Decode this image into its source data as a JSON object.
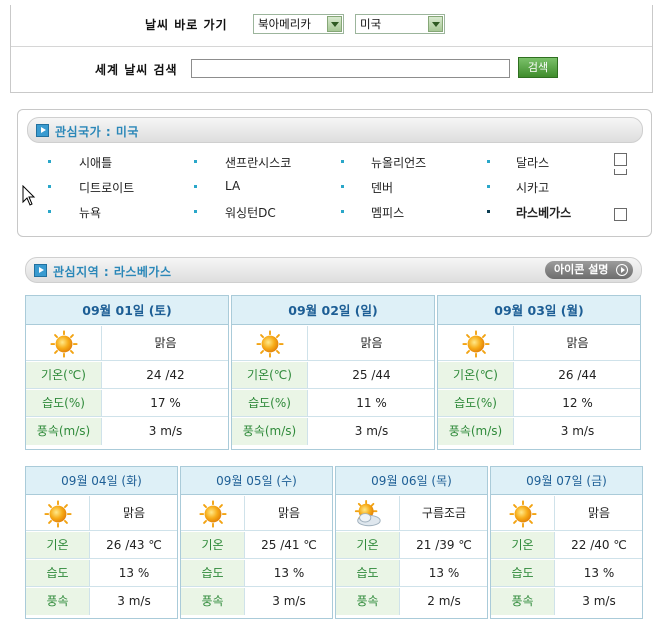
{
  "quick_nav": {
    "label": "날씨 바로 가기",
    "region_selected": "북아메리카",
    "country_selected": "미국"
  },
  "world_search": {
    "label": "세계 날씨 검색",
    "input_value": "",
    "button_label": "검색"
  },
  "interest_country": {
    "title": "관심국가 : 미국",
    "cities": [
      [
        "시애틀",
        "샌프란시스코",
        "뉴올리언즈",
        "달라스"
      ],
      [
        "디트로이트",
        "LA",
        "덴버",
        "시카고"
      ],
      [
        "뉴욕",
        "워싱턴DC",
        "멤피스",
        "라스베가스"
      ]
    ]
  },
  "interest_area": {
    "title": "관심지역 : 라스베가스",
    "legend_button": "아이콘 설명"
  },
  "forecast_top": [
    {
      "date": "09월 01일 (토)",
      "weather_icon": "sun-icon",
      "weather": "맑음",
      "temp_label": "기온(℃)",
      "temp": "24 /42",
      "humidity_label": "습도(%)",
      "humidity": "17 %",
      "wind_label": "풍속(m/s)",
      "wind": "3 m/s"
    },
    {
      "date": "09월 02일 (일)",
      "weather_icon": "sun-icon",
      "weather": "맑음",
      "temp_label": "기온(℃)",
      "temp": "25 /44",
      "humidity_label": "습도(%)",
      "humidity": "11 %",
      "wind_label": "풍속(m/s)",
      "wind": "3 m/s"
    },
    {
      "date": "09월 03일 (월)",
      "weather_icon": "sun-icon",
      "weather": "맑음",
      "temp_label": "기온(℃)",
      "temp": "26 /44",
      "humidity_label": "습도(%)",
      "humidity": "12 %",
      "wind_label": "풍속(m/s)",
      "wind": "3 m/s"
    }
  ],
  "forecast_bottom": [
    {
      "date": "09월 04일 (화)",
      "weather_icon": "sun-icon",
      "weather": "맑음",
      "temp_label": "기온",
      "temp": "26 /43 ℃",
      "humidity_label": "습도",
      "humidity": "13 %",
      "wind_label": "풍속",
      "wind": "3 m/s"
    },
    {
      "date": "09월 05일 (수)",
      "weather_icon": "sun-icon",
      "weather": "맑음",
      "temp_label": "기온",
      "temp": "25 /41 ℃",
      "humidity_label": "습도",
      "humidity": "13 %",
      "wind_label": "풍속",
      "wind": "3 m/s"
    },
    {
      "date": "09월 06일 (목)",
      "weather_icon": "partly-cloudy-icon",
      "weather": "구름조금",
      "temp_label": "기온",
      "temp": "21 /39 ℃",
      "humidity_label": "습도",
      "humidity": "13 %",
      "wind_label": "풍속",
      "wind": "2 m/s"
    },
    {
      "date": "09월 07일 (금)",
      "weather_icon": "sun-icon",
      "weather": "맑음",
      "temp_label": "기온",
      "temp": "22 /40 ℃",
      "humidity_label": "습도",
      "humidity": "13 %",
      "wind_label": "풍속",
      "wind": "3 m/s"
    }
  ]
}
